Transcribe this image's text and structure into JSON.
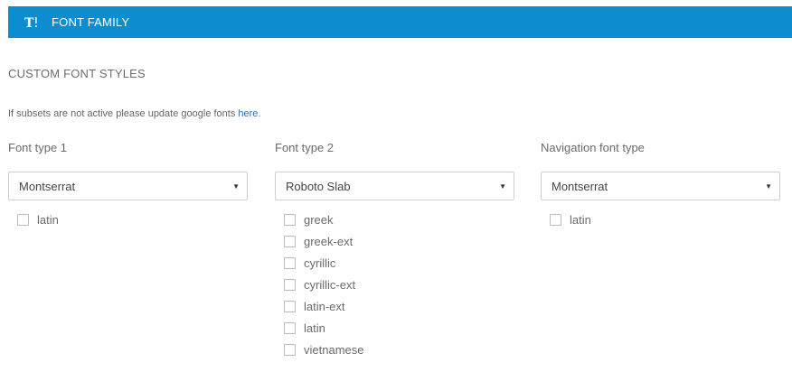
{
  "header": {
    "title": "FONT FAMILY",
    "icon": "text-format-icon"
  },
  "section": {
    "title": "CUSTOM FONT STYLES",
    "info_text": "If subsets are not active please update google fonts ",
    "info_link": "here",
    "info_suffix": "."
  },
  "columns": [
    {
      "label": "Font type 1",
      "selected": "Montserrat",
      "subsets": [
        "latin"
      ]
    },
    {
      "label": "Font type 2",
      "selected": "Roboto Slab",
      "subsets": [
        "greek",
        "greek-ext",
        "cyrillic",
        "cyrillic-ext",
        "latin-ext",
        "latin",
        "vietnamese"
      ]
    },
    {
      "label": "Navigation font type",
      "selected": "Montserrat",
      "subsets": [
        "latin"
      ]
    }
  ],
  "colors": {
    "header_bg": "#0d8ccf",
    "link": "#2a6fb2"
  }
}
